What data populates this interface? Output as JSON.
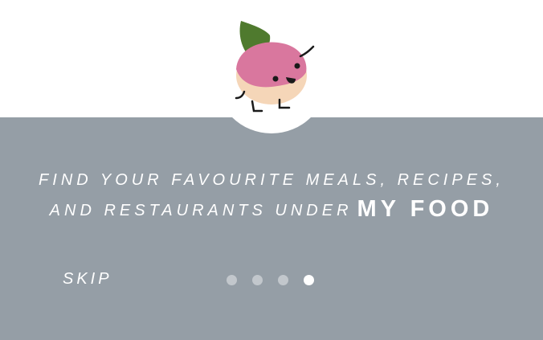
{
  "caption": {
    "line1": "FIND YOUR FAVOURITE MEALS, RECIPES,",
    "line2": "AND RESTAURANTS UNDER",
    "brand": "MY FOOD"
  },
  "skip_label": "SKIP",
  "pagination": {
    "count": 4,
    "active_index": 3
  },
  "mascot": {
    "icon": "turnip-mascot-icon",
    "colors": {
      "leaf": "#4f7a2e",
      "body_top": "#d9779e",
      "body_bottom": "#f5d6b8",
      "features": "#1a1a1a"
    }
  },
  "colors": {
    "panel_background": "#959ea6",
    "text": "#ffffff",
    "dot_inactive": "#c2c7cc",
    "dot_active": "#ffffff"
  }
}
